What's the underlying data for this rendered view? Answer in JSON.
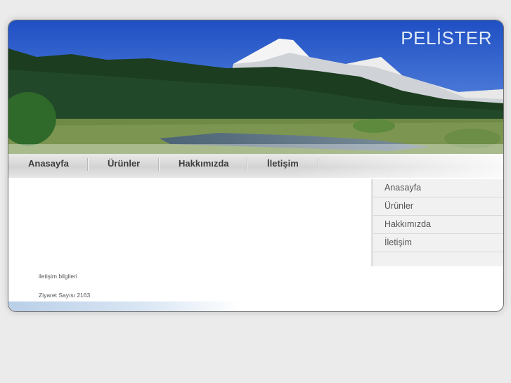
{
  "site": {
    "title": "PELİSTER"
  },
  "topnav": {
    "items": [
      "Anasayfa",
      "Ürünler",
      "Hakkımızda",
      "İletişim"
    ]
  },
  "sidebar": {
    "items": [
      "Anasayfa",
      "Ürünler",
      "Hakkımızda",
      "İletişim"
    ]
  },
  "content": {
    "contact_link": "iletişim bilgileri",
    "visitor_count": "Ziyaret Sayısı 2163"
  },
  "colors": {
    "sky": "#2a5fd0",
    "forest": "#1c3d1f",
    "page_bg": "#ebebeb"
  }
}
